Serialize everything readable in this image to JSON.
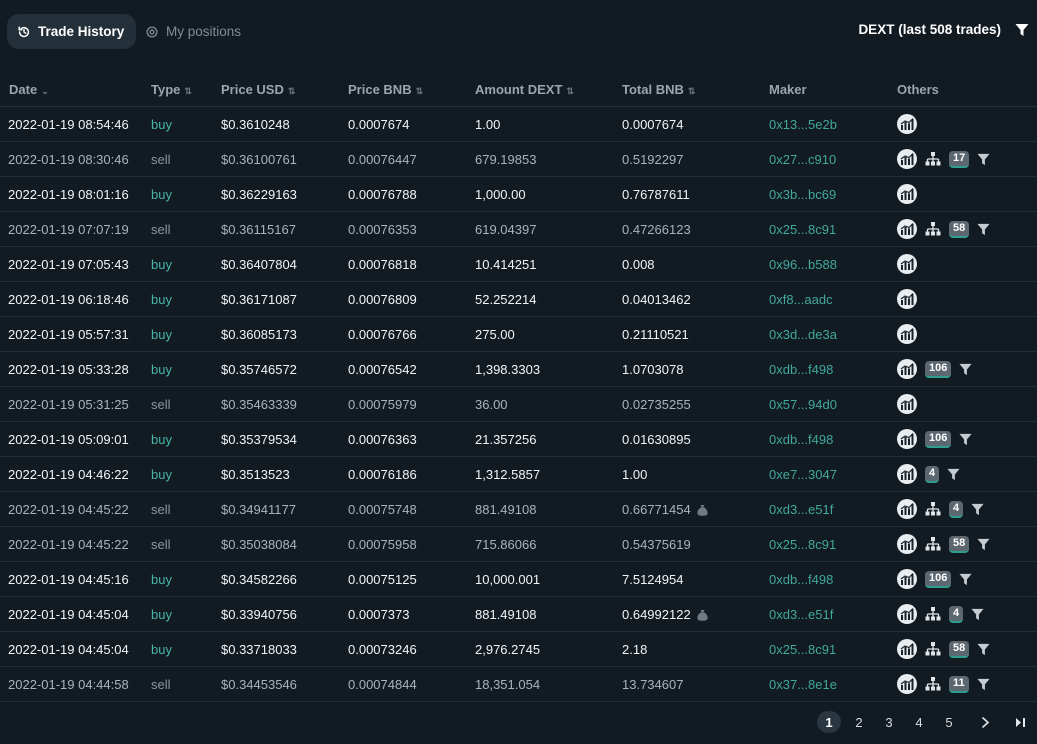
{
  "tabs": {
    "trade_history": "Trade History",
    "my_positions": "My positions"
  },
  "summary": "DEXT (last 508 trades)",
  "columns": {
    "date": "Date",
    "type": "Type",
    "price_usd": "Price USD",
    "price_bnb": "Price BNB",
    "amount": "Amount DEXT",
    "total_bnb": "Total BNB",
    "maker": "Maker",
    "others": "Others"
  },
  "rows": [
    {
      "date": "2022-01-19 08:54:46",
      "type": "buy",
      "price_usd": "$0.3610248",
      "price_bnb": "0.0007674",
      "amount": "1.00",
      "total": "0.0007674",
      "maker": "0x13...5e2b",
      "tree": false,
      "badge": "",
      "filter": false,
      "bag": false
    },
    {
      "date": "2022-01-19 08:30:46",
      "type": "sell",
      "price_usd": "$0.36100761",
      "price_bnb": "0.00076447",
      "amount": "679.19853",
      "total": "0.5192297",
      "maker": "0x27...c910",
      "tree": true,
      "badge": "17",
      "filter": true,
      "bag": false
    },
    {
      "date": "2022-01-19 08:01:16",
      "type": "buy",
      "price_usd": "$0.36229163",
      "price_bnb": "0.00076788",
      "amount": "1,000.00",
      "total": "0.76787611",
      "maker": "0x3b...bc69",
      "tree": false,
      "badge": "",
      "filter": false,
      "bag": false
    },
    {
      "date": "2022-01-19 07:07:19",
      "type": "sell",
      "price_usd": "$0.36115167",
      "price_bnb": "0.00076353",
      "amount": "619.04397",
      "total": "0.47266123",
      "maker": "0x25...8c91",
      "tree": true,
      "badge": "58",
      "filter": true,
      "bag": false
    },
    {
      "date": "2022-01-19 07:05:43",
      "type": "buy",
      "price_usd": "$0.36407804",
      "price_bnb": "0.00076818",
      "amount": "10.414251",
      "total": "0.008",
      "maker": "0x96...b588",
      "tree": false,
      "badge": "",
      "filter": false,
      "bag": false
    },
    {
      "date": "2022-01-19 06:18:46",
      "type": "buy",
      "price_usd": "$0.36171087",
      "price_bnb": "0.00076809",
      "amount": "52.252214",
      "total": "0.04013462",
      "maker": "0xf8...aadc",
      "tree": false,
      "badge": "",
      "filter": false,
      "bag": false
    },
    {
      "date": "2022-01-19 05:57:31",
      "type": "buy",
      "price_usd": "$0.36085173",
      "price_bnb": "0.00076766",
      "amount": "275.00",
      "total": "0.21110521",
      "maker": "0x3d...de3a",
      "tree": false,
      "badge": "",
      "filter": false,
      "bag": false
    },
    {
      "date": "2022-01-19 05:33:28",
      "type": "buy",
      "price_usd": "$0.35746572",
      "price_bnb": "0.00076542",
      "amount": "1,398.3303",
      "total": "1.0703078",
      "maker": "0xdb...f498",
      "tree": false,
      "badge": "106",
      "filter": true,
      "bag": false
    },
    {
      "date": "2022-01-19 05:31:25",
      "type": "sell",
      "price_usd": "$0.35463339",
      "price_bnb": "0.00075979",
      "amount": "36.00",
      "total": "0.02735255",
      "maker": "0x57...94d0",
      "tree": false,
      "badge": "",
      "filter": false,
      "bag": false
    },
    {
      "date": "2022-01-19 05:09:01",
      "type": "buy",
      "price_usd": "$0.35379534",
      "price_bnb": "0.00076363",
      "amount": "21.357256",
      "total": "0.01630895",
      "maker": "0xdb...f498",
      "tree": false,
      "badge": "106",
      "filter": true,
      "bag": false
    },
    {
      "date": "2022-01-19 04:46:22",
      "type": "buy",
      "price_usd": "$0.3513523",
      "price_bnb": "0.00076186",
      "amount": "1,312.5857",
      "total": "1.00",
      "maker": "0xe7...3047",
      "tree": false,
      "badge": "4",
      "filter": true,
      "bag": false
    },
    {
      "date": "2022-01-19 04:45:22",
      "type": "sell",
      "price_usd": "$0.34941177",
      "price_bnb": "0.00075748",
      "amount": "881.49108",
      "total": "0.66771454",
      "maker": "0xd3...e51f",
      "tree": true,
      "badge": "4",
      "filter": true,
      "bag": true
    },
    {
      "date": "2022-01-19 04:45:22",
      "type": "sell",
      "price_usd": "$0.35038084",
      "price_bnb": "0.00075958",
      "amount": "715.86066",
      "total": "0.54375619",
      "maker": "0x25...8c91",
      "tree": true,
      "badge": "58",
      "filter": true,
      "bag": false
    },
    {
      "date": "2022-01-19 04:45:16",
      "type": "buy",
      "price_usd": "$0.34582266",
      "price_bnb": "0.00075125",
      "amount": "10,000.001",
      "total": "7.5124954",
      "maker": "0xdb...f498",
      "tree": false,
      "badge": "106",
      "filter": true,
      "bag": false
    },
    {
      "date": "2022-01-19 04:45:04",
      "type": "buy",
      "price_usd": "$0.33940756",
      "price_bnb": "0.0007373",
      "amount": "881.49108",
      "total": "0.64992122",
      "maker": "0xd3...e51f",
      "tree": true,
      "badge": "4",
      "filter": true,
      "bag": true
    },
    {
      "date": "2022-01-19 04:45:04",
      "type": "buy",
      "price_usd": "$0.33718033",
      "price_bnb": "0.00073246",
      "amount": "2,976.2745",
      "total": "2.18",
      "maker": "0x25...8c91",
      "tree": true,
      "badge": "58",
      "filter": true,
      "bag": false
    },
    {
      "date": "2022-01-19 04:44:58",
      "type": "sell",
      "price_usd": "$0.34453546",
      "price_bnb": "0.00074844",
      "amount": "18,351.054",
      "total": "13.734607",
      "maker": "0x37...8e1e",
      "tree": true,
      "badge": "11",
      "filter": true,
      "bag": false
    }
  ],
  "pagination": {
    "pages": [
      "1",
      "2",
      "3",
      "4",
      "5"
    ],
    "current": "1"
  },
  "icons": {
    "history": "history-icon",
    "positions": "positions-icon",
    "filter": "filter-icon",
    "chart": "chart-icon",
    "tree": "hierarchy-icon",
    "bag": "money-bag-icon",
    "next": "chevron-right-icon",
    "last": "last-page-icon"
  },
  "colors": {
    "background": "#131b22",
    "buy": "#47b5a8",
    "maker_link": "#41a89b",
    "badge": "#5d6770"
  }
}
